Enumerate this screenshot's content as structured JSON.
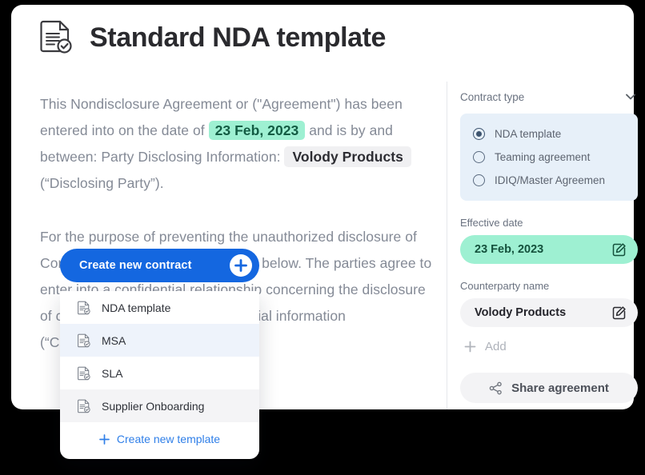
{
  "header": {
    "title": "Standard NDA template",
    "icon": "document-check-icon"
  },
  "document": {
    "paragraph1": {
      "seg1": "This Nondisclosure Agreement or (\"Agreement\") has been entered into on the date of ",
      "date_pill": "23 Feb, 2023",
      "seg2": " and is by and between: Party Disclosing Information: ",
      "party_pill": "Volody Products",
      "seg3": " (“Disclosing Party”)."
    },
    "paragraph2": "For the purpose of preventing the unauthorized disclosure of Confidential Information as defined below. The parties agree to enter into a confidential relationship concerning the disclosure of certain proprietary and confidential information (“Confidential Information”)."
  },
  "cta": {
    "label": "Create new contract",
    "plus_icon": "plus-icon"
  },
  "dropdown": {
    "items": [
      {
        "label": "NDA template",
        "icon": "document-check-icon",
        "state": "normal"
      },
      {
        "label": "MSA",
        "icon": "document-check-icon",
        "state": "hover"
      },
      {
        "label": "SLA",
        "icon": "document-check-icon",
        "state": "normal"
      },
      {
        "label": "Supplier Onboarding",
        "icon": "document-check-icon",
        "state": "active"
      }
    ],
    "footer": {
      "label": "Create new template",
      "icon": "plus-icon",
      "color": "#2f7fe8"
    }
  },
  "sidebar": {
    "contract_type": {
      "label": "Contract type",
      "collapse_icon": "chevron-down-icon",
      "options": [
        {
          "label": "NDA template",
          "selected": true
        },
        {
          "label": "Teaming agreement",
          "selected": false
        },
        {
          "label": "IDIQ/Master Agreemen",
          "selected": false
        }
      ],
      "group_bg": "#e7f0f9"
    },
    "effective_date": {
      "label": "Effective date",
      "value": "23 Feb, 2023",
      "edit_icon": "edit-square-icon",
      "pill_color": "#9ef0d2"
    },
    "counterparty": {
      "label": "Counterparty name",
      "value": "Volody Products",
      "edit_icon": "edit-square-icon",
      "pill_color": "#f3f3f5"
    },
    "add_field": {
      "label": "Add",
      "icon": "plus-icon"
    },
    "share": {
      "label": "Share agreement",
      "icon": "share-icon"
    }
  }
}
